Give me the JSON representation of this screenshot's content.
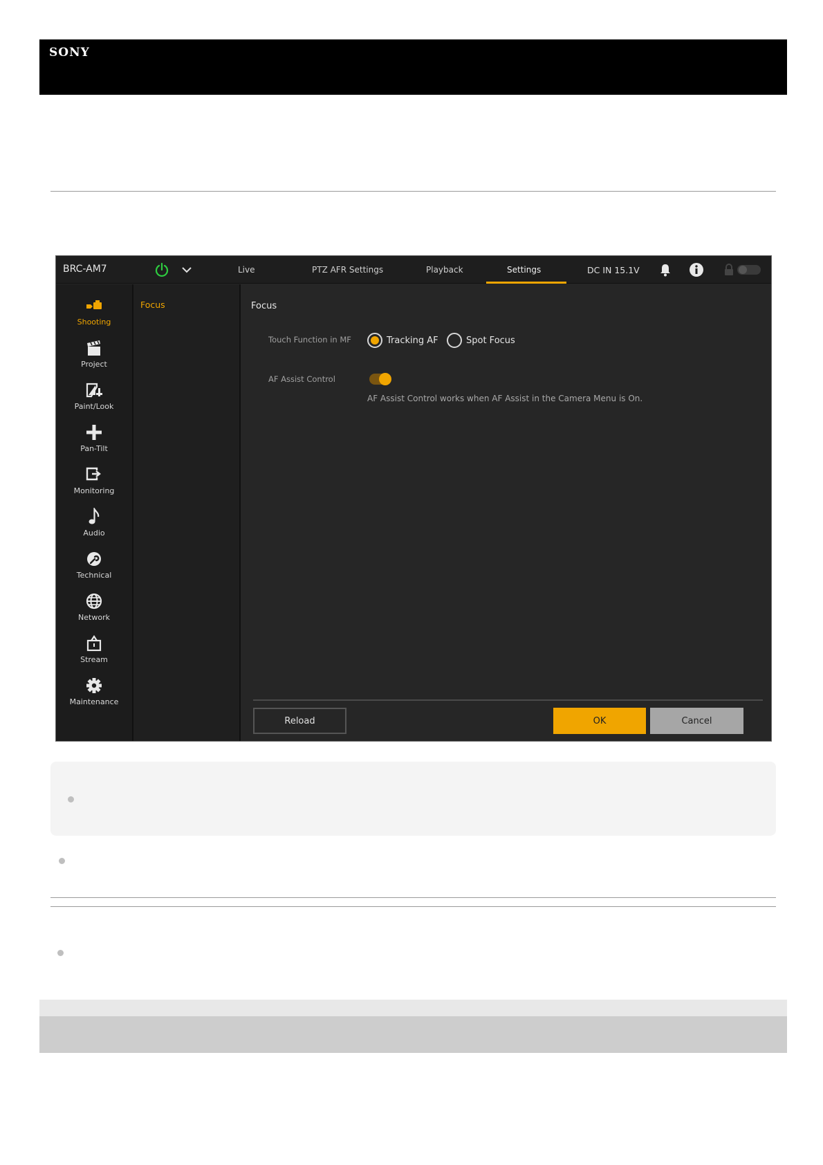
{
  "brand": {
    "logo_text": "SONY"
  },
  "app": {
    "model": "BRC-AM7",
    "tabs": [
      {
        "label": "Live",
        "active": false
      },
      {
        "label": "PTZ AFR Settings",
        "active": false
      },
      {
        "label": "Playback",
        "active": false
      },
      {
        "label": "Settings",
        "active": true
      }
    ],
    "status": {
      "dc_in": "DC IN 15.1V"
    },
    "sidebar": [
      {
        "label": "Shooting",
        "icon": "camera-icon",
        "active": true
      },
      {
        "label": "Project",
        "icon": "clapperboard-icon",
        "active": false
      },
      {
        "label": "Paint/Look",
        "icon": "paint-icon",
        "active": false
      },
      {
        "label": "Pan-Tilt",
        "icon": "cross-arrows-icon",
        "active": false
      },
      {
        "label": "Monitoring",
        "icon": "monitor-output-icon",
        "active": false
      },
      {
        "label": "Audio",
        "icon": "music-note-icon",
        "active": false
      },
      {
        "label": "Technical",
        "icon": "wrench-icon",
        "active": false
      },
      {
        "label": "Network",
        "icon": "globe-icon",
        "active": false
      },
      {
        "label": "Stream",
        "icon": "stream-icon",
        "active": false
      },
      {
        "label": "Maintenance",
        "icon": "gear-icon",
        "active": false
      }
    ],
    "subnav": {
      "item": "Focus"
    },
    "panel": {
      "title": "Focus",
      "touch_function_label": "Touch Function in MF",
      "options": [
        {
          "label": "Tracking AF",
          "selected": true
        },
        {
          "label": "Spot Focus",
          "selected": false
        }
      ],
      "af_assist_label": "AF Assist Control",
      "af_assist_on": true,
      "af_assist_note": "AF Assist Control works when AF Assist in the Camera Menu is On."
    },
    "buttons": {
      "reload": "Reload",
      "ok": "OK",
      "cancel": "Cancel"
    },
    "colors": {
      "accent": "#f0a500",
      "power": "#2ecc40"
    }
  }
}
